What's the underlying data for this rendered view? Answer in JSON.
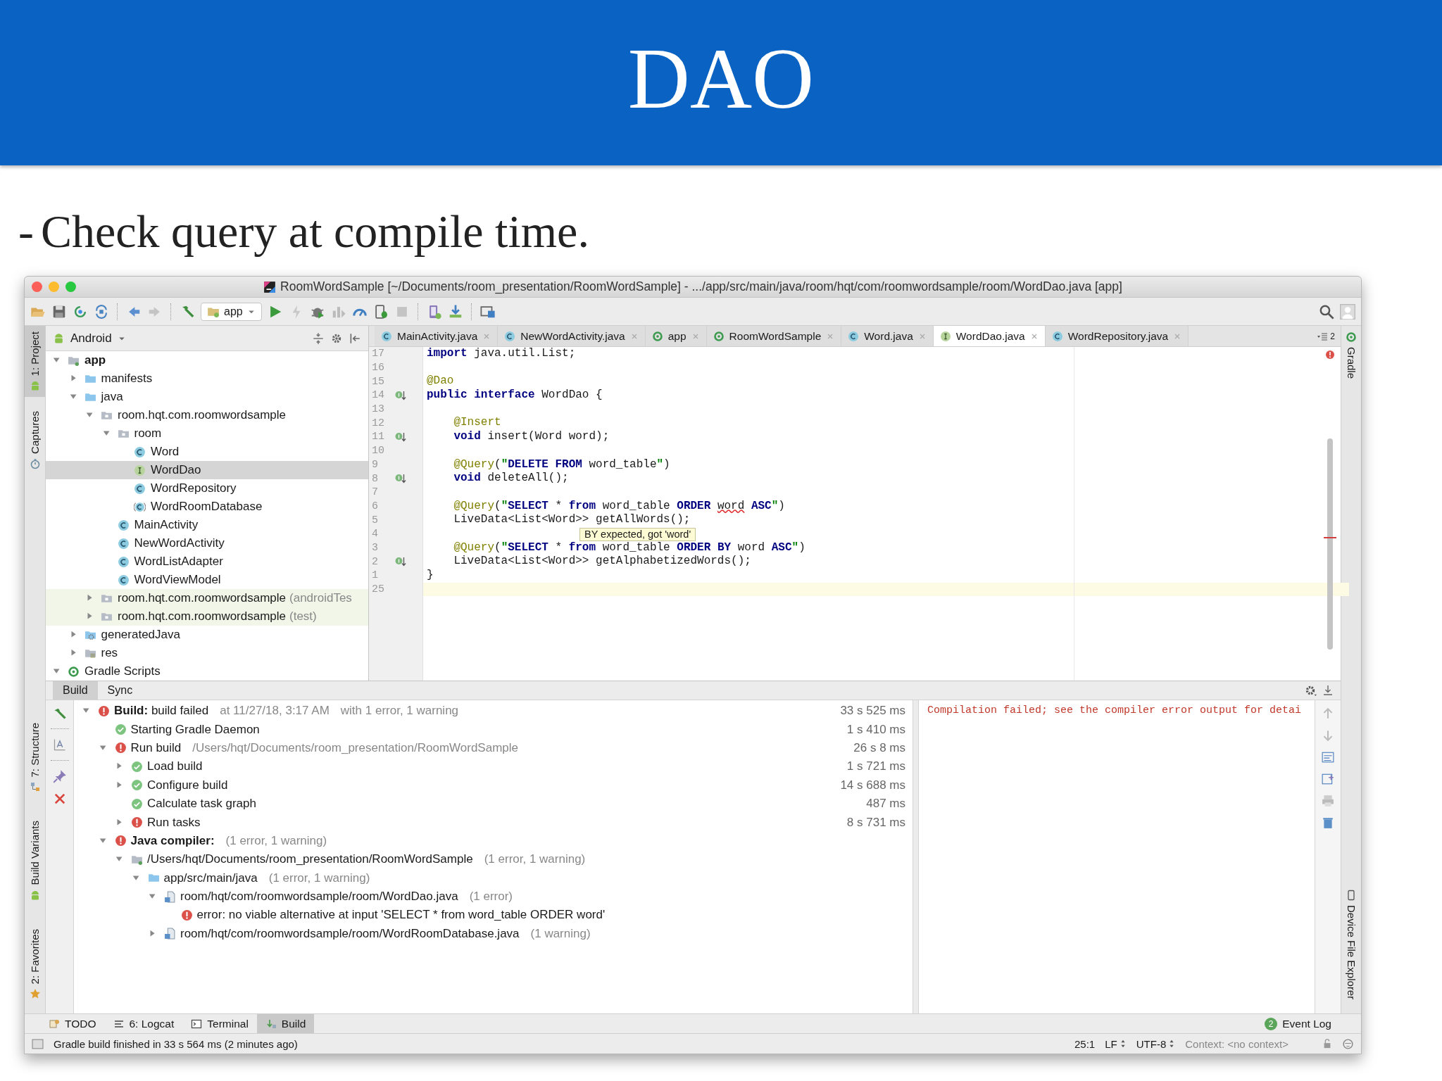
{
  "slide": {
    "title": "DAO",
    "bullet": "-",
    "text": "Check query at compile time."
  },
  "window": {
    "title": "RoomWordSample [~/Documents/room_presentation/RoomWordSample] - .../app/src/main/java/room/hqt/com/roomwordsample/room/WordDao.java [app]"
  },
  "toolbar": {
    "run_config": "app"
  },
  "left_tool_strip": [
    {
      "label": "1: Project",
      "kind": "android",
      "selected": true
    },
    {
      "label": "Captures",
      "kind": "timer",
      "selected": false
    },
    {
      "label": "7: Structure",
      "kind": "structure",
      "selected": false
    },
    {
      "label": "Build Variants",
      "kind": "android",
      "selected": false
    },
    {
      "label": "2: Favorites",
      "kind": "star",
      "selected": false
    }
  ],
  "right_tool_strip": [
    {
      "label": "Gradle",
      "kind": "gradle",
      "selected": false
    },
    {
      "label": "Device File Explorer",
      "kind": "device",
      "selected": false
    }
  ],
  "project": {
    "view": "Android",
    "tree": [
      {
        "label": "app",
        "kind": "module",
        "expanded": true,
        "selected": false,
        "children": [
          {
            "label": "manifests",
            "kind": "folder",
            "expanded": false,
            "selected": false
          },
          {
            "label": "java",
            "kind": "folder",
            "expanded": true,
            "selected": false,
            "children": [
              {
                "label": "room.hqt.com.roomwordsample",
                "kind": "package",
                "expanded": true,
                "selected": false,
                "children": [
                  {
                    "label": "room",
                    "kind": "package",
                    "expanded": true,
                    "selected": false,
                    "children": [
                      {
                        "label": "Word",
                        "kind": "class",
                        "selected": false
                      },
                      {
                        "label": "WordDao",
                        "kind": "interface",
                        "selected": true
                      },
                      {
                        "label": "WordRepository",
                        "kind": "class",
                        "selected": false
                      },
                      {
                        "label": "WordRoomDatabase",
                        "kind": "abstract-class",
                        "selected": false
                      }
                    ]
                  },
                  {
                    "label": "MainActivity",
                    "kind": "class",
                    "selected": false
                  },
                  {
                    "label": "NewWordActivity",
                    "kind": "class",
                    "selected": false
                  },
                  {
                    "label": "WordListAdapter",
                    "kind": "class",
                    "selected": false
                  },
                  {
                    "label": "WordViewModel",
                    "kind": "class",
                    "selected": false
                  }
                ]
              },
              {
                "label": "room.hqt.com.roomwordsample",
                "note": "(androidTes",
                "kind": "test-package",
                "expanded": false,
                "selected": false
              },
              {
                "label": "room.hqt.com.roomwordsample",
                "note": "(test)",
                "kind": "test-package",
                "expanded": false,
                "selected": false
              }
            ]
          },
          {
            "label": "generatedJava",
            "kind": "generated-folder",
            "expanded": false,
            "selected": false
          },
          {
            "label": "res",
            "kind": "res-folder",
            "expanded": false,
            "selected": false
          }
        ]
      },
      {
        "label": "Gradle Scripts",
        "kind": "gradle",
        "expanded": true,
        "selected": false
      }
    ]
  },
  "editor": {
    "tabs": [
      {
        "label": "MainActivity.java",
        "kind": "class",
        "selected": false
      },
      {
        "label": "NewWordActivity.java",
        "kind": "class",
        "selected": false
      },
      {
        "label": "app",
        "kind": "gradle",
        "selected": false
      },
      {
        "label": "RoomWordSample",
        "kind": "gradle",
        "selected": false
      },
      {
        "label": "Word.java",
        "kind": "class",
        "selected": false
      },
      {
        "label": "WordDao.java",
        "kind": "interface",
        "selected": true
      },
      {
        "label": "WordRepository.java",
        "kind": "class",
        "selected": false
      }
    ],
    "hidden_tabs": "2",
    "lines": [
      {
        "number": "17",
        "marker": false,
        "current": false,
        "tokens": [
          {
            "kind": "kw",
            "text": "import"
          },
          {
            "kind": "p",
            "text": " java.util.List;"
          }
        ]
      },
      {
        "number": "16",
        "marker": false,
        "current": false
      },
      {
        "number": "15",
        "marker": false,
        "current": false,
        "tokens": [
          {
            "kind": "ann",
            "text": "@Dao"
          }
        ]
      },
      {
        "number": "14",
        "marker": true,
        "current": false,
        "tokens": [
          {
            "kind": "kw",
            "text": "public interface"
          },
          {
            "kind": "p",
            "text": " WordDao {"
          }
        ]
      },
      {
        "number": "13",
        "marker": false,
        "current": false
      },
      {
        "number": "12",
        "marker": false,
        "current": false,
        "tokens": [
          {
            "kind": "ann",
            "text": "    @Insert"
          }
        ]
      },
      {
        "number": "11",
        "marker": true,
        "current": false,
        "tokens": [
          {
            "kind": "kw",
            "text": "    void"
          },
          {
            "kind": "p",
            "text": " insert(Word word);"
          }
        ]
      },
      {
        "number": "10",
        "marker": false,
        "current": false
      },
      {
        "number": "9",
        "marker": false,
        "current": false,
        "tokens": [
          {
            "kind": "ann",
            "text": "    @Query"
          },
          {
            "kind": "p",
            "text": "("
          },
          {
            "kind": "str",
            "text": "\""
          },
          {
            "kind": "sql",
            "text": "DELETE FROM"
          },
          {
            "kind": "p",
            "text": " word_table"
          },
          {
            "kind": "str",
            "text": "\""
          },
          {
            "kind": "p",
            "text": ")"
          }
        ]
      },
      {
        "number": "8",
        "marker": true,
        "current": false,
        "tokens": [
          {
            "kind": "kw",
            "text": "    void"
          },
          {
            "kind": "p",
            "text": " deleteAll();"
          }
        ]
      },
      {
        "number": "7",
        "marker": false,
        "current": false
      },
      {
        "number": "6",
        "marker": false,
        "current": false,
        "tokens": [
          {
            "kind": "ann",
            "text": "    @Query"
          },
          {
            "kind": "p",
            "text": "("
          },
          {
            "kind": "str",
            "text": "\""
          },
          {
            "kind": "sql",
            "text": "SELECT"
          },
          {
            "kind": "p",
            "text": " * "
          },
          {
            "kind": "sql",
            "text": "from"
          },
          {
            "kind": "p",
            "text": " word_table "
          },
          {
            "kind": "sql",
            "text": "ORDER "
          },
          {
            "kind": "err",
            "text": "word"
          },
          {
            "kind": "sql",
            "text": " ASC"
          },
          {
            "kind": "str",
            "text": "\""
          },
          {
            "kind": "p",
            "text": ")"
          }
        ]
      },
      {
        "number": "5",
        "marker": false,
        "current": false,
        "tokens": [
          {
            "kind": "p",
            "text": "    LiveData<List<Word>> getAllWords();"
          }
        ]
      },
      {
        "number": "4",
        "marker": false,
        "current": false
      },
      {
        "number": "3",
        "marker": false,
        "current": false,
        "tokens": [
          {
            "kind": "ann",
            "text": "    @Query"
          },
          {
            "kind": "p",
            "text": "("
          },
          {
            "kind": "str",
            "text": "\""
          },
          {
            "kind": "sql",
            "text": "SELECT"
          },
          {
            "kind": "p",
            "text": " * "
          },
          {
            "kind": "sql",
            "text": "from"
          },
          {
            "kind": "p",
            "text": " word_table "
          },
          {
            "kind": "sql",
            "text": "ORDER BY"
          },
          {
            "kind": "p",
            "text": " word "
          },
          {
            "kind": "sql",
            "text": "ASC"
          },
          {
            "kind": "str",
            "text": "\""
          },
          {
            "kind": "p",
            "text": ")"
          }
        ]
      },
      {
        "number": "2",
        "marker": true,
        "current": false,
        "tokens": [
          {
            "kind": "p",
            "text": "    LiveData<List<Word>> getAlphabetizedWords();"
          }
        ]
      },
      {
        "number": "1",
        "marker": false,
        "current": false,
        "tokens": [
          {
            "kind": "p",
            "text": "}"
          }
        ]
      },
      {
        "number": "25",
        "marker": false,
        "current": true
      }
    ],
    "tooltip": "BY expected, got 'word'"
  },
  "build": {
    "tabs": [
      {
        "label": "Build",
        "selected": true
      },
      {
        "label": "Sync",
        "selected": false
      }
    ],
    "tree": [
      {
        "title": "**Build:** build failed",
        "details": [
          "at 11/27/18, 3:17 AM",
          "with 1 error, 1 warning"
        ],
        "time": "33 s 525 ms",
        "kind": "error",
        "expanded": true,
        "children": [
          {
            "title": "Starting Gradle Daemon",
            "kind": "ok",
            "time": "1 s 410 ms"
          },
          {
            "title": "Run build",
            "details": [
              "/Users/hqt/Documents/room_presentation/RoomWordSample"
            ],
            "time": "26 s 8 ms",
            "kind": "error",
            "expanded": true,
            "children": [
              {
                "title": "Load build",
                "kind": "ok",
                "time": "1 s 721 ms",
                "expanded": false
              },
              {
                "title": "Configure build",
                "kind": "ok",
                "time": "14 s 688 ms",
                "expanded": false
              },
              {
                "title": "Calculate task graph",
                "kind": "ok",
                "time": "487 ms"
              },
              {
                "title": "Run tasks",
                "kind": "error",
                "time": "8 s 731 ms",
                "expanded": false
              }
            ]
          },
          {
            "title": "Java compiler:",
            "details": [
              "(1 error, 1 warning)"
            ],
            "kind": "compiler",
            "expanded": true,
            "children": [
              {
                "title": "/Users/hqt/Documents/room_presentation/RoomWordSample",
                "details": [
                  "(1 error, 1 warning)"
                ],
                "kind": "module",
                "expanded": true,
                "children": [
                  {
                    "title": "app/src/main/java",
                    "details": [
                      "(1 error, 1 warning)"
                    ],
                    "kind": "folder",
                    "expanded": true,
                    "children": [
                      {
                        "title": "room/hqt/com/roomwordsample/room/WordDao.java",
                        "details": [
                          "(1 error)"
                        ],
                        "kind": "java-file",
                        "expanded": true,
                        "children": [
                          {
                            "title": "error: no viable alternative at input 'SELECT * from word_table ORDER word'",
                            "kind": "error"
                          }
                        ]
                      },
                      {
                        "title": "room/hqt/com/roomwordsample/room/WordRoomDatabase.java",
                        "details": [
                          "(1 warning)"
                        ],
                        "kind": "java-file",
                        "expanded": false
                      }
                    ]
                  }
                ]
              }
            ]
          }
        ]
      }
    ],
    "output": "Compilation failed; see the compiler error output for detai"
  },
  "tool_tabs": [
    {
      "label": "TODO",
      "kind": "todo",
      "selected": false
    },
    {
      "label": "6: Logcat",
      "kind": "logcat",
      "selected": false
    },
    {
      "label": "Terminal",
      "kind": "terminal",
      "selected": false
    },
    {
      "label": "Build",
      "kind": "build",
      "selected": true
    }
  ],
  "event_log": {
    "label": "Event Log",
    "count": "2"
  },
  "status_bar": {
    "message": "Gradle build finished in 33 s 564 ms (2 minutes ago)",
    "position": "25:1",
    "line_separator": "LF",
    "encoding": "UTF-8",
    "context": "Context: <no context>"
  }
}
